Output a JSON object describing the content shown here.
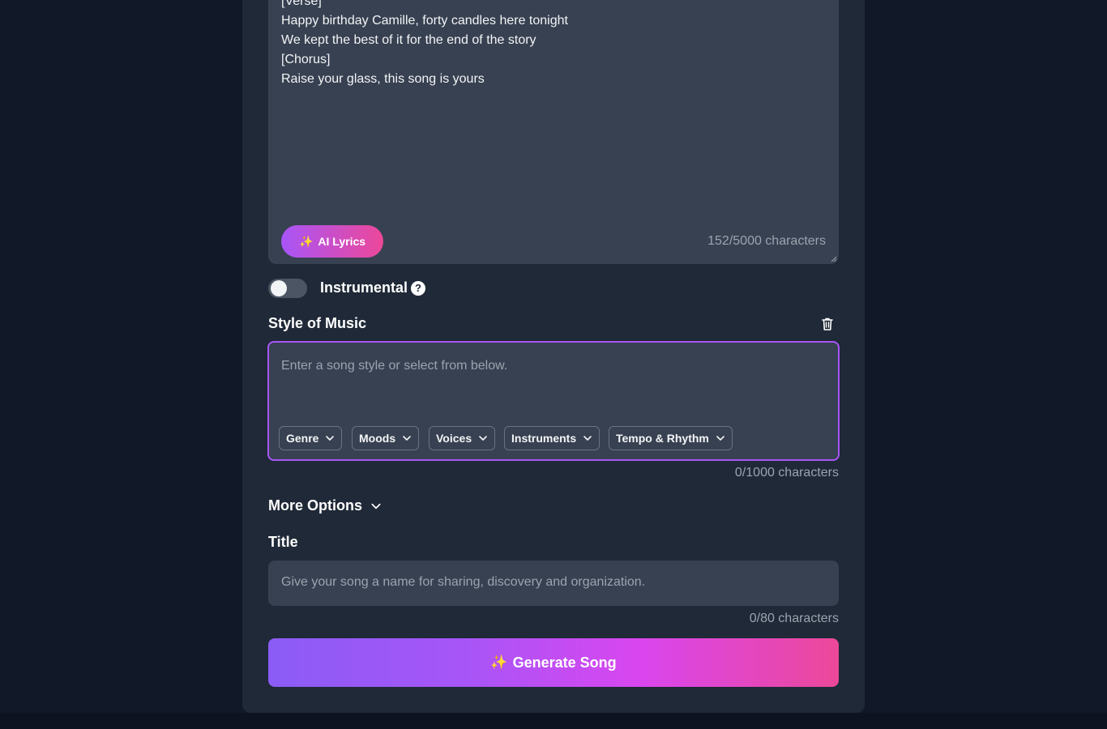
{
  "lyrics": {
    "lines": [
      "[Verse]",
      "Happy birthday Camille, forty candles here tonight",
      "We kept the best of it for the end of the story",
      "[Chorus]",
      "Raise your glass, this song is yours"
    ],
    "ai_button_label": "AI Lyrics",
    "sparkle": "✨",
    "char_count": "152/5000 characters"
  },
  "instrumental": {
    "label": "Instrumental",
    "help_glyph": "?",
    "enabled": false
  },
  "style": {
    "label": "Style of Music",
    "placeholder": "Enter a song style or select from below.",
    "char_count": "0/1000 characters",
    "chips": [
      "Genre",
      "Moods",
      "Voices",
      "Instruments",
      "Tempo & Rhythm"
    ]
  },
  "more_options": {
    "label": "More Options"
  },
  "title_field": {
    "label": "Title",
    "placeholder": "Give your song a name for sharing, discovery and organization.",
    "char_count": "0/80 characters"
  },
  "generate": {
    "label": "Generate Song",
    "sparkle": "✨"
  },
  "colors": {
    "accent_purple": "#a855f7",
    "accent_pink": "#ec4899",
    "panel_bg": "#1f2937",
    "input_bg": "#374151"
  }
}
